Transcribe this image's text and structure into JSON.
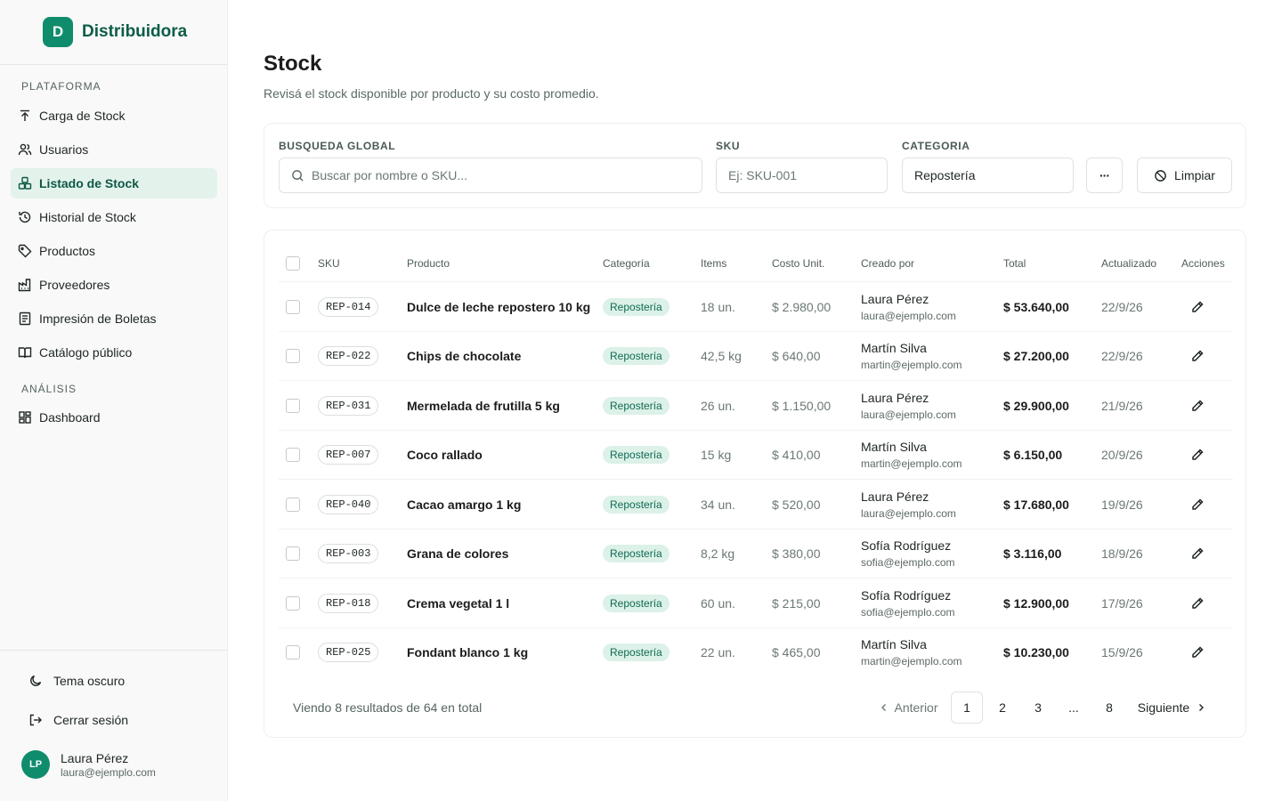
{
  "brand": {
    "logo_letter": "D",
    "name": "Distribuidora",
    "color": "#0f8c6c"
  },
  "sidebar": {
    "sections": [
      {
        "label": "PLATAFORMA"
      },
      {
        "label": "ANÁLISIS"
      }
    ],
    "items": [
      {
        "label": "Carga de Stock",
        "icon": "upload-icon"
      },
      {
        "label": "Usuarios",
        "icon": "users-icon"
      },
      {
        "label": "Listado de Stock",
        "icon": "boxes-icon",
        "active": true
      },
      {
        "label": "Historial de Stock",
        "icon": "history-icon"
      },
      {
        "label": "Productos",
        "icon": "tag-icon"
      },
      {
        "label": "Proveedores",
        "icon": "factory-icon"
      },
      {
        "label": "Impresión de Boletas",
        "icon": "receipt-icon"
      },
      {
        "label": "Catálogo público",
        "icon": "book-icon"
      },
      {
        "label": "Dashboard",
        "icon": "dashboard-icon"
      }
    ],
    "bottom": {
      "theme_label": "Tema oscuro",
      "logout_label": "Cerrar sesión"
    },
    "user": {
      "initials": "LP",
      "name": "Laura Pérez",
      "email": "laura@ejemplo.com"
    }
  },
  "page": {
    "title": "Stock",
    "subtitle": "Revisá el stock disponible por producto y su costo promedio."
  },
  "filters": {
    "search_label": "BUSQUEDA GLOBAL",
    "search_placeholder": "Buscar por nombre o SKU...",
    "sku_label": "SKU",
    "sku_placeholder": "Ej: SKU-001",
    "category_label": "CATEGORIA",
    "category_value": "Repostería",
    "more_label": "···",
    "clear_label": "Limpiar"
  },
  "table": {
    "headers": {
      "sku": "SKU",
      "product": "Producto",
      "category": "Categoría",
      "items": "Items",
      "unit_cost": "Costo Unit.",
      "created_by": "Creado por",
      "total": "Total",
      "updated": "Actualizado",
      "actions": "Acciones"
    },
    "rows": [
      {
        "sku": "REP-014",
        "product": "Dulce de leche repostero 10 kg",
        "category": "Repostería",
        "items": "18 un.",
        "unit_cost": "$ 2.980,00",
        "creator_name": "Laura Pérez",
        "creator_email": "laura@ejemplo.com",
        "total": "$ 53.640,00",
        "updated": "22/9/26"
      },
      {
        "sku": "REP-022",
        "product": "Chips de chocolate",
        "category": "Repostería",
        "items": "42,5 kg",
        "unit_cost": "$ 640,00",
        "creator_name": "Martín Silva",
        "creator_email": "martin@ejemplo.com",
        "total": "$ 27.200,00",
        "updated": "22/9/26"
      },
      {
        "sku": "REP-031",
        "product": "Mermelada de frutilla 5 kg",
        "category": "Repostería",
        "items": "26 un.",
        "unit_cost": "$ 1.150,00",
        "creator_name": "Laura Pérez",
        "creator_email": "laura@ejemplo.com",
        "total": "$ 29.900,00",
        "updated": "21/9/26"
      },
      {
        "sku": "REP-007",
        "product": "Coco rallado",
        "category": "Repostería",
        "items": "15 kg",
        "unit_cost": "$ 410,00",
        "creator_name": "Martín Silva",
        "creator_email": "martin@ejemplo.com",
        "total": "$ 6.150,00",
        "updated": "20/9/26"
      },
      {
        "sku": "REP-040",
        "product": "Cacao amargo 1 kg",
        "category": "Repostería",
        "items": "34 un.",
        "unit_cost": "$ 520,00",
        "creator_name": "Laura Pérez",
        "creator_email": "laura@ejemplo.com",
        "total": "$ 17.680,00",
        "updated": "19/9/26"
      },
      {
        "sku": "REP-003",
        "product": "Grana de colores",
        "category": "Repostería",
        "items": "8,2 kg",
        "unit_cost": "$ 380,00",
        "creator_name": "Sofía Rodríguez",
        "creator_email": "sofia@ejemplo.com",
        "total": "$ 3.116,00",
        "updated": "18/9/26"
      },
      {
        "sku": "REP-018",
        "product": "Crema vegetal 1 l",
        "category": "Repostería",
        "items": "60 un.",
        "unit_cost": "$ 215,00",
        "creator_name": "Sofía Rodríguez",
        "creator_email": "sofia@ejemplo.com",
        "total": "$ 12.900,00",
        "updated": "17/9/26"
      },
      {
        "sku": "REP-025",
        "product": "Fondant blanco 1 kg",
        "category": "Repostería",
        "items": "22 un.",
        "unit_cost": "$ 465,00",
        "creator_name": "Martín Silva",
        "creator_email": "martin@ejemplo.com",
        "total": "$ 10.230,00",
        "updated": "15/9/26"
      }
    ]
  },
  "pagination": {
    "info": "Viendo 8 resultados de 64 en total",
    "prev_label": "Anterior",
    "next_label": "Siguiente",
    "pages": [
      "1",
      "2",
      "3",
      "...",
      "8"
    ],
    "current": "1"
  }
}
